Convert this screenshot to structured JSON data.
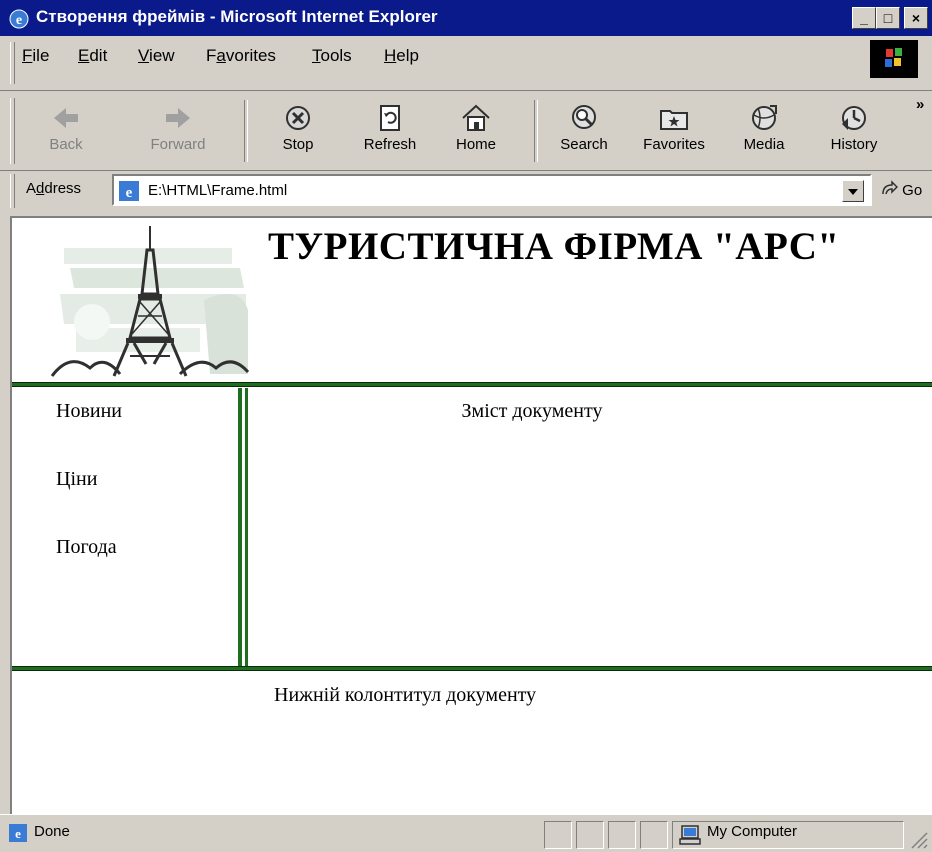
{
  "window": {
    "title": "Створення фреймів - Microsoft Internet Explorer",
    "controls": {
      "minimize": "_",
      "maximize": "□",
      "close": "×"
    }
  },
  "menu": {
    "items": [
      {
        "pre": "",
        "key": "F",
        "post": "ile"
      },
      {
        "pre": "",
        "key": "E",
        "post": "dit"
      },
      {
        "pre": "",
        "key": "V",
        "post": "iew"
      },
      {
        "pre": "F",
        "key": "a",
        "post": "vorites"
      },
      {
        "pre": "",
        "key": "T",
        "post": "ools"
      },
      {
        "pre": "",
        "key": "H",
        "post": "elp"
      }
    ]
  },
  "toolbar": {
    "back": "Back",
    "forward": "Forward",
    "stop": "Stop",
    "refresh": "Refresh",
    "home": "Home",
    "search": "Search",
    "favorites": "Favorites",
    "media": "Media",
    "history": "History",
    "more": "»"
  },
  "address": {
    "label_pre": "A",
    "label_key": "d",
    "label_post": "dress",
    "value": "E:\\HTML\\Frame.html",
    "go": "Go"
  },
  "page": {
    "header_title": "ТУРИСТИЧНА ФІРМА \"АРС\"",
    "nav": [
      "Новини",
      "Ціни",
      "Погода"
    ],
    "main_text": "Зміст документу",
    "footer_text": "Нижній колонтитул документу"
  },
  "status": {
    "text": "Done",
    "zone": "My Computer"
  },
  "colors": {
    "titlebar": "#0a1a8a",
    "frame_border": "#1f6e1f",
    "chrome": "#d4d0c8"
  }
}
